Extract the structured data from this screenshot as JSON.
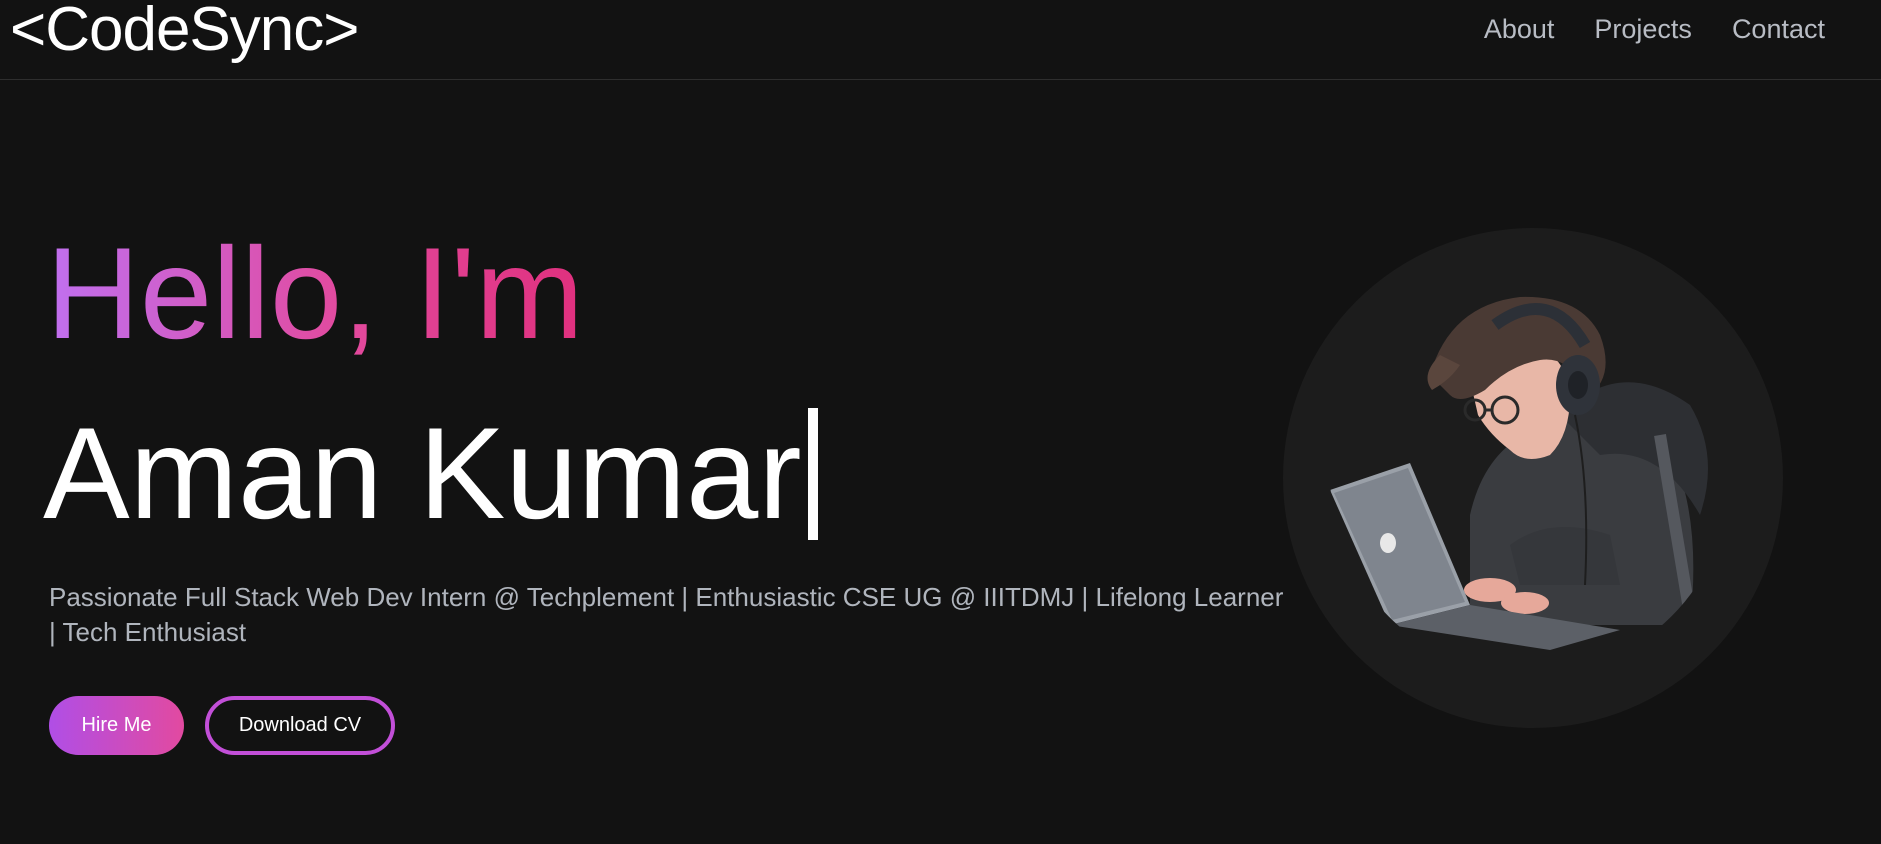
{
  "header": {
    "logo": "<CodeSync>",
    "nav": [
      "About",
      "Projects",
      "Contact"
    ]
  },
  "hero": {
    "greeting": "Hello, I'm",
    "name": "Aman Kumar",
    "tagline": "Passionate Full Stack Web Dev Intern @ Techplement | Enthusiastic CSE UG @ IIITDMJ | Lifelong Learner | Tech Enthusiast",
    "hire_label": "Hire Me",
    "cv_label": "Download CV"
  },
  "colors": {
    "background": "#121212",
    "accent_purple": "#c070f0",
    "accent_pink": "#e0307e"
  },
  "illustration": "developer-with-headphones-on-laptop-illustration"
}
